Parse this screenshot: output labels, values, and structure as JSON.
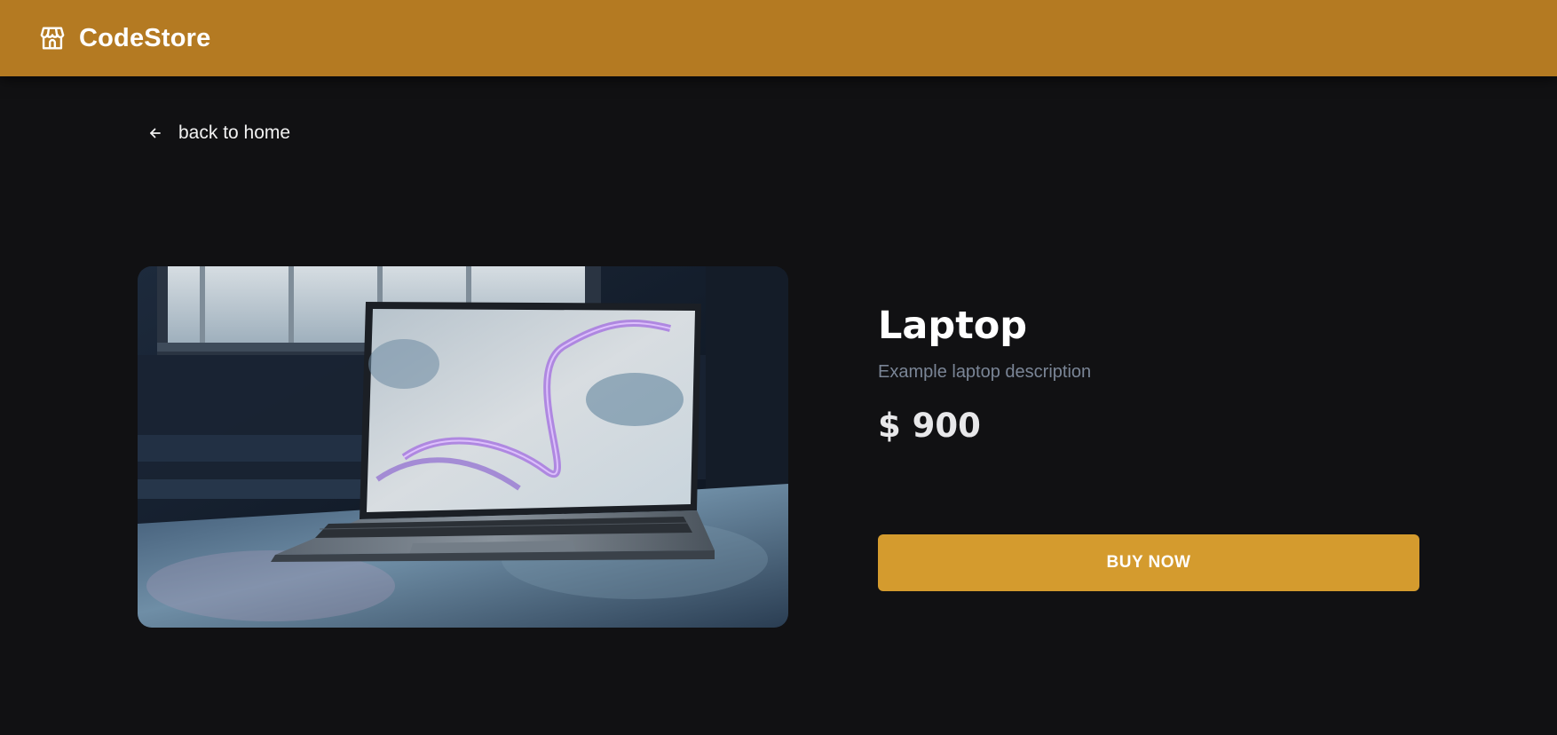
{
  "header": {
    "brand_name": "CodeStore",
    "brand_icon": "storefront-icon",
    "background_color": "#b47a22"
  },
  "navigation": {
    "back_label": "back to home",
    "back_icon": "arrow-left-icon"
  },
  "product": {
    "image_subject": "laptop-photo",
    "title": "Laptop",
    "description": "Example laptop description",
    "price": "$ 900",
    "buy_label": "BUY NOW",
    "buy_color": "#d49b2e"
  },
  "theme": {
    "page_background": "#111113",
    "muted_text": "#7a8596"
  }
}
